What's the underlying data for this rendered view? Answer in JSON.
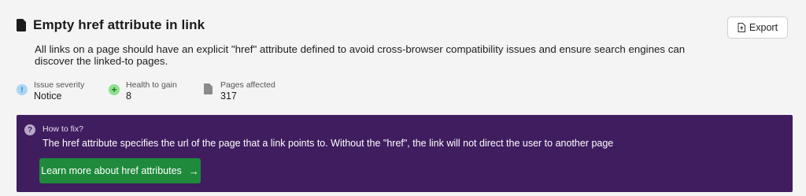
{
  "header": {
    "title": "Empty href attribute in link",
    "export_label": "Export"
  },
  "description": "All links on a page should have an explicit \"href\" attribute defined to avoid cross-browser compatibility issues and ensure search engines can discover the linked-to pages.",
  "metrics": [
    {
      "label": "Issue severity",
      "value": "Notice",
      "icon": "info-icon"
    },
    {
      "label": "Health to gain",
      "value": "8",
      "icon": "plus-icon"
    },
    {
      "label": "Pages affected",
      "value": "317",
      "icon": "page-icon"
    }
  ],
  "fix": {
    "title": "How to fix?",
    "text": "The href attribute specifies the url of the page that a link points to. Without the \"href\", the link will not direct the user to another page",
    "button_label": "Learn more about href attributes"
  },
  "colors": {
    "panel_bg": "#3f1d5e",
    "button_green": "#1f8a3c",
    "severity_blue": "#a9d7f5",
    "health_green": "#8fe08f"
  },
  "icons": {
    "title": "document-icon",
    "export": "export-file-icon",
    "fix": "question-icon",
    "learn": "arrow-right-icon"
  }
}
